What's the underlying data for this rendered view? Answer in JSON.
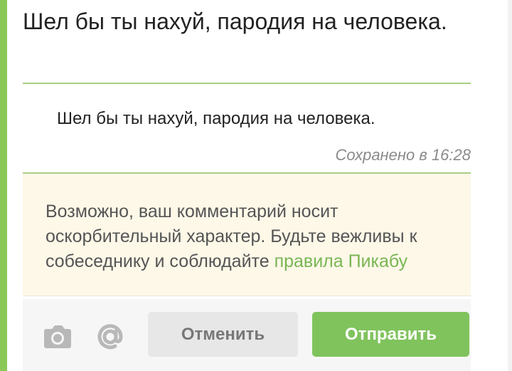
{
  "quote": {
    "text": "Шел бы ты нахуй, пародия на человека."
  },
  "editor": {
    "text": "Шел бы ты нахуй, пародия на человека.",
    "saved_status": "Сохранено в 16:28"
  },
  "warning": {
    "text": "Возможно, ваш комментарий носит оскорбительный характер. Будьте вежливы к собеседнику и соблюдайте ",
    "link_text": "правила Пикабу"
  },
  "toolbar": {
    "camera_icon": "camera-icon",
    "mention_icon": "at-icon",
    "cancel_label": "Отменить",
    "send_label": "Отправить"
  },
  "colors": {
    "accent": "#8ac858",
    "send_button": "#80c35d",
    "warning_background": "#fdf8e8",
    "link": "#7ab553"
  }
}
